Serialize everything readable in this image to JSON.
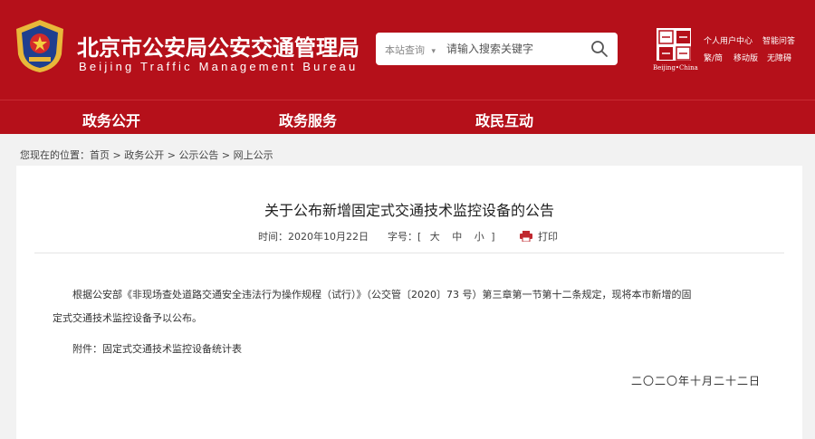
{
  "header": {
    "site_name_cn": "北京市公安局公安交通管理局",
    "site_name_en": "Beijing Traffic Management Bureau",
    "capital_logo_text": "Beijing•China",
    "links": {
      "personal_center": "个人用户中心",
      "smart_qa": "智能问答",
      "trad_simp": "繁/简",
      "mobile": "移动版",
      "accessibility": "无障碍"
    }
  },
  "search": {
    "scope_label": "本站查询",
    "scope_arrow": "▾",
    "placeholder": "请输入搜索关键字"
  },
  "nav": {
    "items": [
      {
        "label": "政务公开"
      },
      {
        "label": "政务服务"
      },
      {
        "label": "政民互动"
      }
    ]
  },
  "breadcrumb": {
    "prefix": "您现在的位置：",
    "items": [
      "首页",
      "政务公开",
      "公示公告",
      "网上公示"
    ],
    "separator": " > "
  },
  "article": {
    "title": "关于公布新增固定式交通技术监控设备的公告",
    "time_label": "时间：2020年10月22日",
    "font_label": "字号：",
    "font_open": "[",
    "font_large": "大",
    "font_medium": "中",
    "font_small": "小",
    "font_close": "]",
    "print_label": "打印",
    "para1_line1": "根据公安部《非现场查处道路交通安全违法行为操作规程（试行）》（公交管〔2020〕73 号）第三章第一节第十二条规定，现将本市新增的固",
    "para1_line2": "定式交通技术监控设备予以公布。",
    "attachment": "附件：固定式交通技术监控设备统计表",
    "date": "二〇二〇年十月二十二日"
  },
  "colors": {
    "brand_red": "#b5101a",
    "background": "#f2f2f2"
  }
}
